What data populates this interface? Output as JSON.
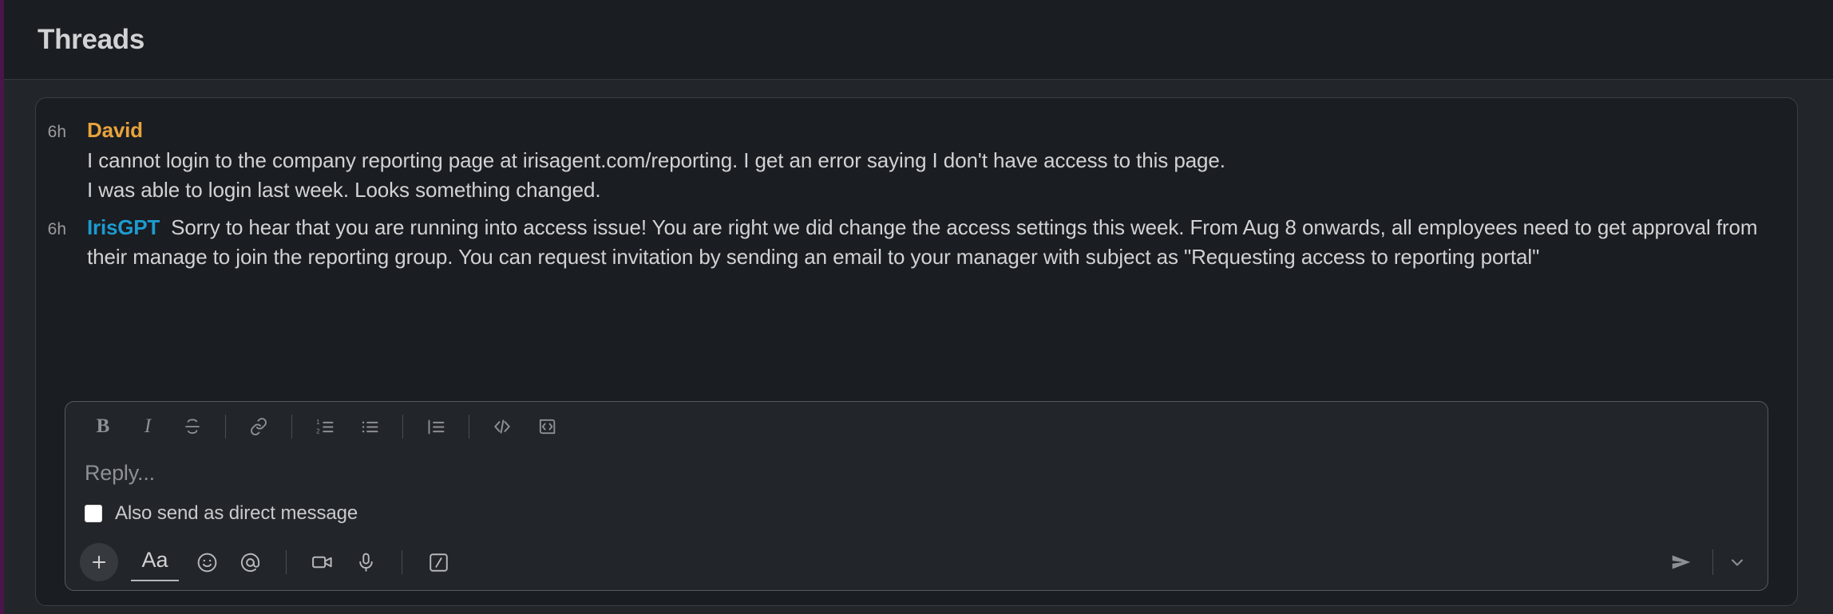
{
  "header": {
    "title": "Threads"
  },
  "thread": {
    "messages": [
      {
        "timestamp": "6h",
        "author": "David",
        "author_color": "#e8a33d",
        "lines": [
          "I cannot login to the company reporting page at irisagent.com/reporting. I get an error saying I don't have access to this page.",
          "I was able to login last week. Looks something changed."
        ]
      },
      {
        "timestamp": "6h",
        "author": "IrisGPT",
        "author_color": "#1d9bd1",
        "text": "Sorry to hear that you are running into access issue! You are right we did change the access settings this week. From Aug 8 onwards, all employees need to get approval from their manage to join the reporting group. You can request invitation by sending an email to your manager with subject as \"Requesting access to reporting portal\""
      }
    ]
  },
  "composer": {
    "format_toolbar": [
      {
        "name": "bold",
        "label": "B"
      },
      {
        "name": "italic",
        "label": "I"
      },
      {
        "name": "strikethrough",
        "label": "S"
      },
      {
        "name": "link",
        "label": ""
      },
      {
        "name": "ordered-list",
        "label": ""
      },
      {
        "name": "bulleted-list",
        "label": ""
      },
      {
        "name": "blockquote",
        "label": ""
      },
      {
        "name": "code",
        "label": "</>"
      },
      {
        "name": "code-block",
        "label": ""
      }
    ],
    "input_placeholder": "Reply...",
    "input_value": "",
    "direct_message_label": "Also send as direct message",
    "direct_message_checked": false,
    "action_toolbar": [
      {
        "name": "add-attachment",
        "label": "+"
      },
      {
        "name": "formatting",
        "label": "Aa"
      },
      {
        "name": "emoji",
        "label": ""
      },
      {
        "name": "mention",
        "label": "@"
      },
      {
        "name": "video-clip",
        "label": ""
      },
      {
        "name": "audio-clip",
        "label": ""
      },
      {
        "name": "slash-command",
        "label": "/"
      }
    ],
    "send_label": "Send",
    "send_options_label": "Send options"
  },
  "colors": {
    "app_background": "#1a1d21",
    "panel_background": "#222529",
    "border": "#3b3e43",
    "text_primary": "#d1d2d3",
    "text_muted": "#8d9096",
    "brand_rail": "#4a154b"
  }
}
